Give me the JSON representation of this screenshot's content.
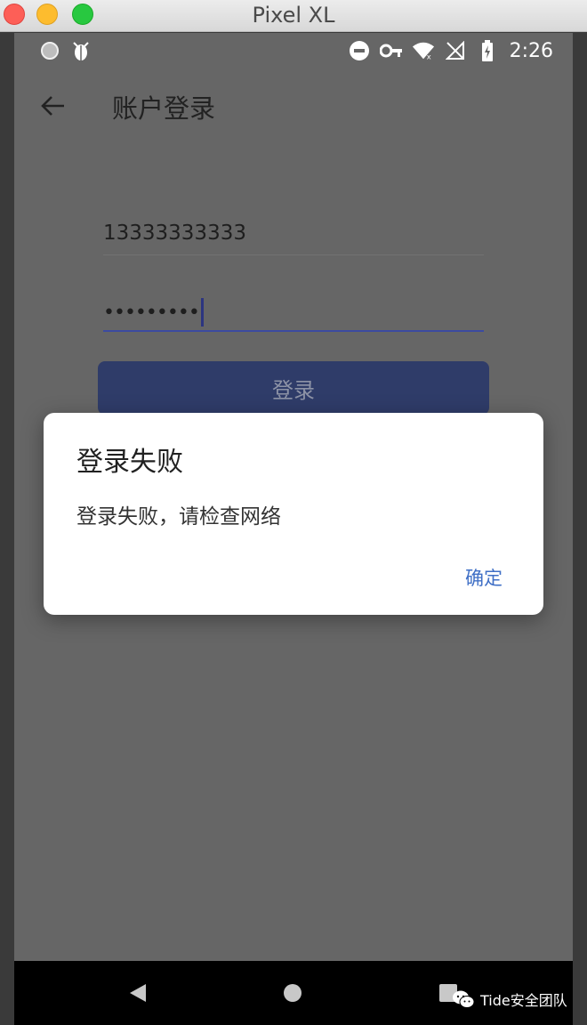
{
  "window": {
    "title": "Pixel XL"
  },
  "status_bar": {
    "time": "2:26"
  },
  "app_bar": {
    "title": "账户登录"
  },
  "form": {
    "phone_value": "13333333333",
    "password_masked": "•••••••••",
    "login_label": "登录"
  },
  "dialog": {
    "title": "登录失败",
    "message": "登录失败，请检查网络",
    "ok_label": "确定"
  },
  "watermark": {
    "text": "Tide安全团队"
  }
}
